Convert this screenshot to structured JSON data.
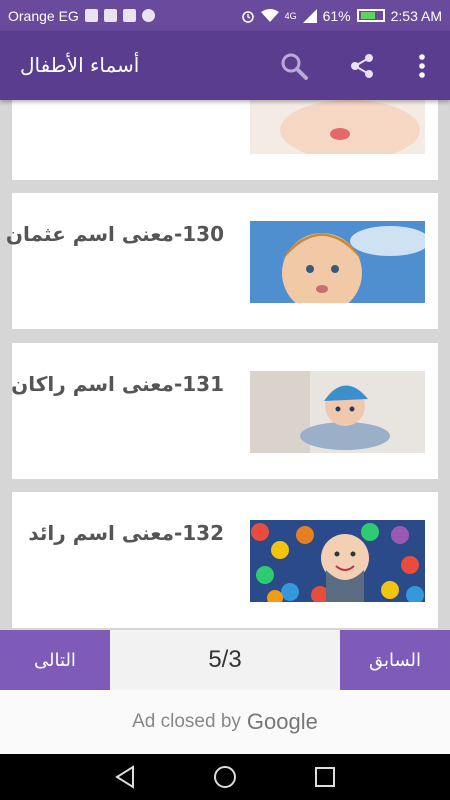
{
  "status": {
    "carrier": "Orange EG",
    "network_badge": "4G",
    "battery": "61%",
    "time": "2:53 AM"
  },
  "app_bar": {
    "title": "أسماء الأطفال",
    "icons": [
      "search-icon",
      "share-icon",
      "more-vert-icon"
    ]
  },
  "cards": [
    {
      "title": ""
    },
    {
      "title": "130-معنى اسم عثمان"
    },
    {
      "title": "131-معنى اسم راكان"
    },
    {
      "title": "132-معنى اسم رائد"
    }
  ],
  "pagination": {
    "next_label": "التالى",
    "page": "5/3",
    "prev_label": "السابق"
  },
  "ad": {
    "text": "Ad closed by",
    "brand": "Google"
  },
  "system_nav": [
    "back-icon",
    "home-icon",
    "recents-icon"
  ],
  "colors": {
    "status_bar": "#6a4a9c",
    "app_bar": "#5b3d8f",
    "nav_button": "#7e5bb8"
  }
}
